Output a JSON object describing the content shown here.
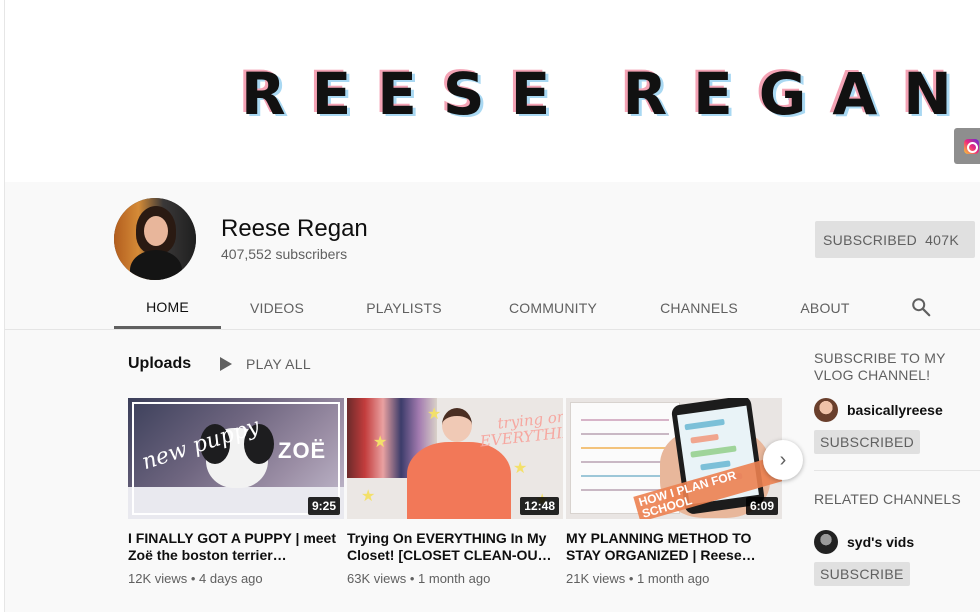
{
  "banner": {
    "title": "REESE REGAN",
    "social_icon": "instagram-icon"
  },
  "channel": {
    "name": "Reese Regan",
    "subscribers": "407,552 subscribers",
    "subscribe_label": "SUBSCRIBED",
    "subscribe_count": "407K"
  },
  "tabs": [
    "HOME",
    "VIDEOS",
    "PLAYLISTS",
    "COMMUNITY",
    "CHANNELS",
    "ABOUT"
  ],
  "active_tab": "HOME",
  "uploads": {
    "heading": "Uploads",
    "play_all": "PLAY ALL",
    "videos": [
      {
        "title": "I FINALLY GOT A PUPPY | meet Zoë the boston terrier…",
        "views": "12K views",
        "age": "4 days ago",
        "duration": "9:25",
        "thumb_text_1": "new puppy",
        "thumb_text_2": "ZOË"
      },
      {
        "title": "Trying On EVERYTHING In My Closet! [CLOSET CLEAN-OU…",
        "views": "63K views",
        "age": "1 month ago",
        "duration": "12:48",
        "thumb_text_1": "trying on EVERYTHING"
      },
      {
        "title": "MY PLANNING METHOD TO STAY ORGANIZED | Reese…",
        "views": "21K views",
        "age": "1 month ago",
        "duration": "6:09",
        "thumb_text_1": "HOW I PLAN FOR SCHOOL"
      }
    ]
  },
  "sidebar": {
    "section1_title": "SUBSCRIBE TO MY VLOG CHANNEL!",
    "channel1_name": "basicallyreese",
    "channel1_btn": "SUBSCRIBED",
    "section2_title": "RELATED CHANNELS",
    "channel2_name": "syd's vids",
    "channel2_btn": "SUBSCRIBE"
  },
  "colors": {
    "accent_gray": "#606060",
    "button_bg": "#e0e0e0",
    "banner_pink": "#f4a3b5",
    "banner_blue": "#a9d8f2"
  }
}
